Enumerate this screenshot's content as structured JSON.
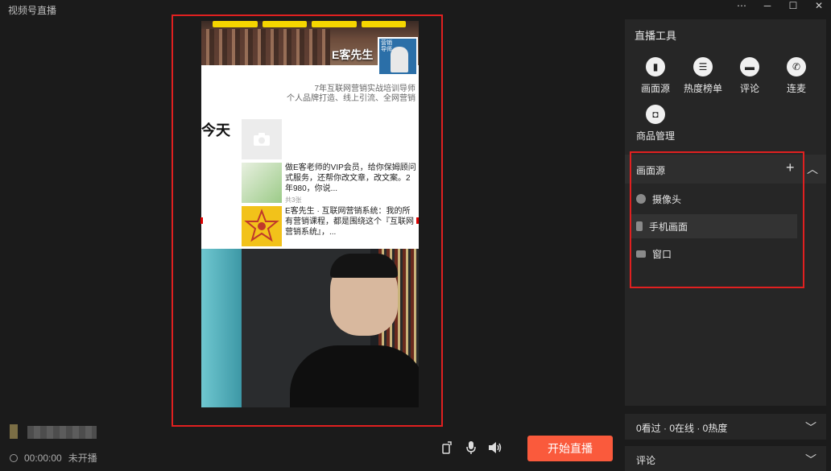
{
  "app": {
    "title": "视频号直播"
  },
  "window": {
    "menu_icon": "⋯",
    "minimize_icon": "─",
    "maximize_icon": "☐",
    "close_icon": "✕"
  },
  "phone": {
    "profile_name": "E客先生",
    "badge_text": "营销导师",
    "bio_line1": "7年互联网营销实战培训导师",
    "bio_line2": "个人品牌打造、线上引流、全网营销",
    "section_label": "今天",
    "posts": [
      {
        "text": "做E客老师的VIP会员，给你保姆顾问式服务，还帮你改文章，改文案。2年980，你说...",
        "count": "共3张"
      },
      {
        "text": "E客先生 · 互联网营销系统：我的所有营销课程，都是围绕这个『互联网营销系统』，...",
        "count": ""
      }
    ]
  },
  "status": {
    "timer": "00:00:00",
    "state": "未开播"
  },
  "controls": {
    "start_label": "开始直播"
  },
  "tools": {
    "title": "直播工具",
    "items": [
      {
        "label": "画面源",
        "icon": "source-icon"
      },
      {
        "label": "热度榜单",
        "icon": "ranking-icon"
      },
      {
        "label": "评论",
        "icon": "comment-icon"
      },
      {
        "label": "连麦",
        "icon": "call-icon"
      },
      {
        "label": "商品管理",
        "icon": "shopping-bag-icon"
      }
    ]
  },
  "sources": {
    "title": "画面源",
    "items": [
      {
        "label": "摄像头"
      },
      {
        "label": "手机画面"
      },
      {
        "label": "窗口"
      }
    ]
  },
  "stats": {
    "text": "0看过 · 0在线 · 0热度"
  },
  "comments": {
    "label": "评论"
  },
  "colors": {
    "accent": "#fa5a3c",
    "highlight": "#e02020",
    "panel": "#262626",
    "background": "#1b1b1b"
  }
}
